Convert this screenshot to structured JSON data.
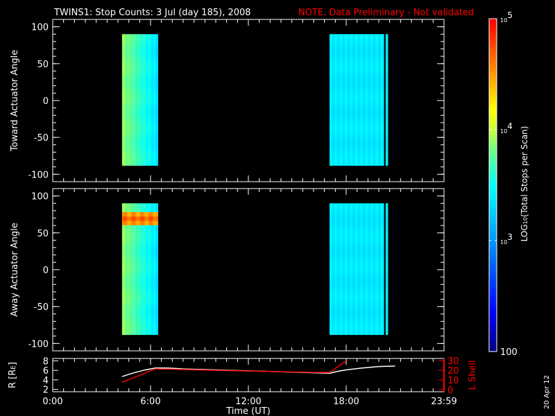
{
  "chart_data": [
    {
      "type": "heatmap",
      "title": "TWINS1: Stop Counts:  3 Jul (day 185), 2008",
      "note": "NOTE. Data Preliminary - Not validated",
      "ylabel": "Toward Actuator Angle",
      "ylim": [
        -110,
        110
      ],
      "yticks": [
        "100",
        "50",
        "0",
        "-50",
        "-100"
      ],
      "ytick_values": [
        100,
        50,
        0,
        -50,
        -100
      ],
      "xlim_hours": [
        0,
        24
      ],
      "angle_range": [
        -88,
        90
      ],
      "blocks": [
        {
          "t_start": 4.25,
          "t_end": 6.45,
          "log_left": 3.9,
          "log_right": 3.35
        },
        {
          "t_start": 16.98,
          "t_end": 20.3,
          "log_left": 3.4,
          "log_right": 3.4
        },
        {
          "t_start": 20.42,
          "t_end": 20.55,
          "log_left": 3.4,
          "log_right": 3.4
        }
      ]
    },
    {
      "type": "heatmap",
      "ylabel": "Away Actuator Angle",
      "ylim": [
        -110,
        110
      ],
      "yticks": [
        "100",
        "50",
        "0",
        "-50",
        "-100"
      ],
      "ytick_values": [
        100,
        50,
        0,
        -50,
        -100
      ],
      "xlim_hours": [
        0,
        24
      ],
      "angle_range": [
        -88,
        90
      ],
      "hotspot": {
        "angle_min": 62,
        "angle_max": 80,
        "log_value": 4.7
      },
      "blocks": [
        {
          "t_start": 4.25,
          "t_end": 6.45,
          "log_left": 3.9,
          "log_right": 3.35
        },
        {
          "t_start": 16.98,
          "t_end": 20.3,
          "log_left": 3.4,
          "log_right": 3.4
        },
        {
          "t_start": 20.42,
          "t_end": 20.55,
          "log_left": 3.4,
          "log_right": 3.4
        }
      ]
    },
    {
      "type": "line",
      "ylabel": "R [R",
      "ylabel_sub": "E",
      "ylabel_close": "]",
      "y2label": "L Shell",
      "xlabel": "Time (UT)",
      "xticks": [
        "0:00",
        "6:00",
        "12:00",
        "18:00",
        "23:59"
      ],
      "xtick_values": [
        0,
        6,
        12,
        18,
        24
      ],
      "yticks": [
        "8",
        "6",
        "4",
        "2"
      ],
      "ytick_values": [
        8,
        6,
        4,
        2
      ],
      "ylim": [
        1.5,
        8.5
      ],
      "y2ticks": [
        "30",
        "20",
        "10",
        "0"
      ],
      "y2tick_values": [
        30,
        20,
        10,
        0
      ],
      "y2lim": [
        -2.3,
        32.3
      ],
      "series": [
        {
          "name": "R",
          "color": "#ffffff",
          "axis": "left",
          "x": [
            4.25,
            5.0,
            5.7,
            6.3,
            7.0,
            8.0,
            10.0,
            12.0,
            14.0,
            16.0,
            17.0,
            17.5,
            18.0,
            19.0,
            20.0,
            21.0
          ],
          "y": [
            4.7,
            5.5,
            6.1,
            6.5,
            6.5,
            6.3,
            6.1,
            5.9,
            5.7,
            5.5,
            5.4,
            5.8,
            6.1,
            6.5,
            6.8,
            6.9
          ]
        },
        {
          "name": "L Shell",
          "color": "#ff0000",
          "axis": "right",
          "x": [
            4.25,
            6.3,
            8.0,
            10.0,
            12.0,
            14.0,
            16.0,
            17.0,
            18.0
          ],
          "y": [
            7.5,
            21.5,
            20.8,
            20.0,
            19.2,
            18.5,
            17.8,
            17.8,
            30
          ]
        }
      ]
    }
  ],
  "colorbar": {
    "label_prefix": "LOG",
    "label_sub": "10",
    "label_rest": "(Total Stops per Scan)",
    "range_log": [
      2,
      5
    ],
    "ticks": [
      {
        "base": "10",
        "exp": "5",
        "log": 5
      },
      {
        "base": "10",
        "exp": "4",
        "log": 4
      },
      {
        "base": "10",
        "exp": "3",
        "log": 3
      },
      {
        "base": "100",
        "exp": "",
        "log": 2
      }
    ]
  },
  "date_stamp": "20 Apr 12",
  "colors": {
    "note": "#ff0000",
    "axes": "#ffffff",
    "lshell": "#ff0000"
  }
}
